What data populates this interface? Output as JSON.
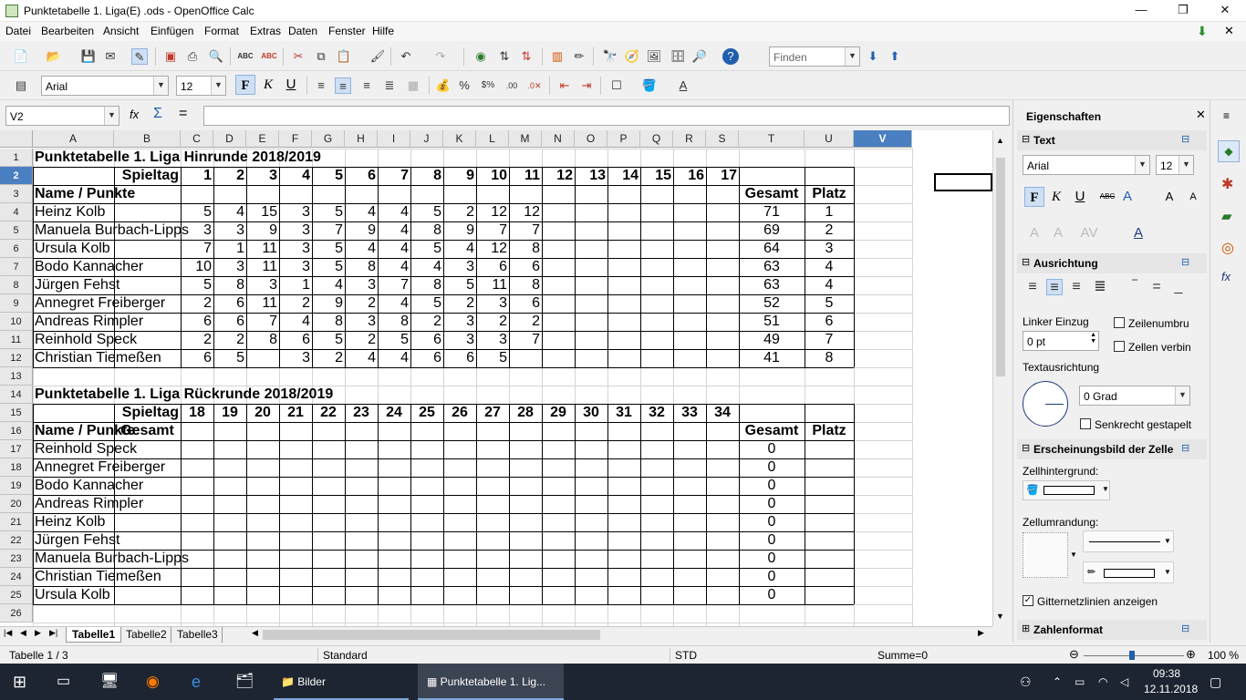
{
  "window": {
    "title": "Punktetabelle 1. Liga(E) .ods - OpenOffice Calc",
    "min": "—",
    "max": "❐",
    "close": "✕"
  },
  "menu": [
    "Datei",
    "Bearbeiten",
    "Ansicht",
    "Einfügen",
    "Format",
    "Extras",
    "Daten",
    "Fenster",
    "Hilfe"
  ],
  "toolbar": {
    "find_placeholder": "Finden",
    "font_name": "Arial",
    "font_size": "12"
  },
  "formula": {
    "cell_ref": "V2",
    "fx": "fx",
    "sum": "Σ",
    "eq": "="
  },
  "columns": [
    "A",
    "B",
    "C",
    "D",
    "E",
    "F",
    "G",
    "H",
    "I",
    "J",
    "K",
    "L",
    "M",
    "N",
    "O",
    "P",
    "Q",
    "R",
    "S",
    "T",
    "U",
    "V"
  ],
  "rows": [
    "1",
    "2",
    "3",
    "4",
    "5",
    "6",
    "7",
    "8",
    "9",
    "10",
    "11",
    "12",
    "13",
    "14",
    "15",
    "16",
    "17",
    "18",
    "19",
    "20",
    "21",
    "22",
    "23",
    "24",
    "25",
    "26"
  ],
  "sheet": {
    "title1": "Punktetabelle 1. Liga Hinrunde 2018/2019",
    "title2": "Punktetabelle 1. Liga Rückrunde 2018/2019",
    "spieltag": "Spieltag",
    "name_punkte": "Name / Punkte",
    "gesamt": "Gesamt",
    "platz": "Platz",
    "spieltage_hin": [
      "1",
      "2",
      "3",
      "4",
      "5",
      "6",
      "7",
      "8",
      "9",
      "10",
      "11",
      "12",
      "13",
      "14",
      "15",
      "16",
      "17"
    ],
    "spieltage_rueck": [
      "18",
      "19",
      "20",
      "21",
      "22",
      "23",
      "24",
      "25",
      "26",
      "27",
      "28",
      "29",
      "30",
      "31",
      "32",
      "33",
      "34"
    ],
    "hinrunde": [
      {
        "name": "Heinz Kolb",
        "pts": [
          "5",
          "4",
          "15",
          "3",
          "5",
          "4",
          "4",
          "5",
          "2",
          "12",
          "12"
        ],
        "gesamt": "71",
        "platz": "1"
      },
      {
        "name": "Manuela Burbach-Lipps",
        "pts": [
          "3",
          "3",
          "9",
          "3",
          "7",
          "9",
          "4",
          "8",
          "9",
          "7",
          "7"
        ],
        "gesamt": "69",
        "platz": "2"
      },
      {
        "name": "Ursula Kolb",
        "pts": [
          "7",
          "1",
          "11",
          "3",
          "5",
          "4",
          "4",
          "5",
          "4",
          "12",
          "8"
        ],
        "gesamt": "64",
        "platz": "3"
      },
      {
        "name": "Bodo Kannacher",
        "pts": [
          "10",
          "3",
          "11",
          "3",
          "5",
          "8",
          "4",
          "4",
          "3",
          "6",
          "6"
        ],
        "gesamt": "63",
        "platz": "4"
      },
      {
        "name": "Jürgen Fehst",
        "pts": [
          "5",
          "8",
          "3",
          "1",
          "4",
          "3",
          "7",
          "8",
          "5",
          "11",
          "8"
        ],
        "gesamt": "63",
        "platz": "4"
      },
      {
        "name": "Annegret Freiberger",
        "pts": [
          "2",
          "6",
          "11",
          "2",
          "9",
          "2",
          "4",
          "5",
          "2",
          "3",
          "6"
        ],
        "gesamt": "52",
        "platz": "5"
      },
      {
        "name": "Andreas Rimpler",
        "pts": [
          "6",
          "6",
          "7",
          "4",
          "8",
          "3",
          "8",
          "2",
          "3",
          "2",
          "2"
        ],
        "gesamt": "51",
        "platz": "6"
      },
      {
        "name": "Reinhold Speck",
        "pts": [
          "2",
          "2",
          "8",
          "6",
          "5",
          "2",
          "5",
          "6",
          "3",
          "3",
          "7"
        ],
        "gesamt": "49",
        "platz": "7"
      },
      {
        "name": "Christian Tiemeßen",
        "pts": [
          "6",
          "5",
          "",
          "3",
          "2",
          "4",
          "4",
          "6",
          "6",
          "5",
          ""
        ],
        "gesamt": "41",
        "platz": "8"
      }
    ],
    "rueckrunde": [
      {
        "name": "Reinhold Speck",
        "gesamt": "0"
      },
      {
        "name": "Annegret Freiberger",
        "gesamt": "0"
      },
      {
        "name": "Bodo Kannacher",
        "gesamt": "0"
      },
      {
        "name": "Andreas Rimpler",
        "gesamt": "0"
      },
      {
        "name": "Heinz Kolb",
        "gesamt": "0"
      },
      {
        "name": "Jürgen Fehst",
        "gesamt": "0"
      },
      {
        "name": "Manuela Burbach-Lipps",
        "gesamt": "0"
      },
      {
        "name": "Christian Tiemeßen",
        "gesamt": "0"
      },
      {
        "name": "Ursula Kolb",
        "gesamt": "0"
      }
    ]
  },
  "sidebar": {
    "title": "Eigenschaften",
    "text_section": "Text",
    "font": "Arial",
    "size": "12",
    "ausrichtung": "Ausrichtung",
    "linker_einzug": "Linker Einzug",
    "einzug_value": "0 pt",
    "zeilenumbruch": "Zeilenumbru",
    "zellen_verbinden": "Zellen verbin",
    "textausrichtung": "Textausrichtung",
    "grad": "0 Grad",
    "senkrecht": "Senkrecht gestapelt",
    "erscheinungsbild": "Erscheinungsbild der Zelle",
    "zellhintergrund": "Zellhintergrund:",
    "zellumrandung": "Zellumrandung:",
    "gitternetz": "Gitternetzlinien anzeigen",
    "zahlenformat": "Zahlenformat"
  },
  "tabs": [
    "Tabelle1",
    "Tabelle2",
    "Tabelle3"
  ],
  "status": {
    "sheet": "Tabelle 1 / 3",
    "style": "Standard",
    "mode": "STD",
    "sum": "Summe=0",
    "zoom": "100 %"
  },
  "taskbar": {
    "bilder": "Bilder",
    "active": "Punktetabelle 1. Lig...",
    "time": "09:38",
    "date": "12.11.2018"
  }
}
